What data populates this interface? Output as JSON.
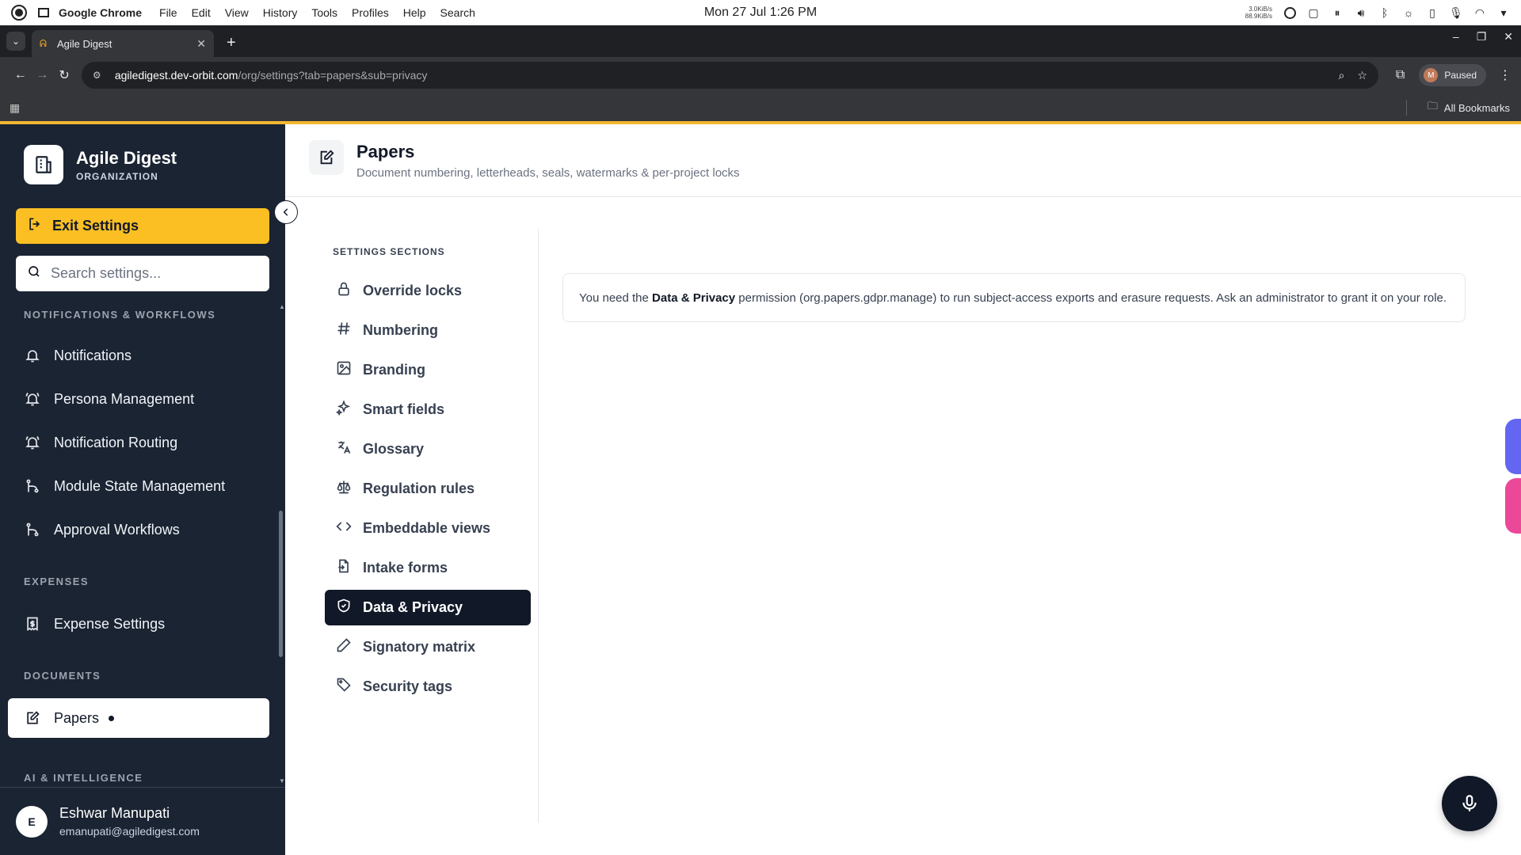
{
  "os": {
    "app_name": "Google Chrome",
    "menus": [
      "File",
      "Edit",
      "View",
      "History",
      "Tools",
      "Profiles",
      "Help",
      "Search"
    ],
    "clock": "Mon 27 Jul  1:26 PM",
    "net_up": "3.0KiB/s",
    "net_down": "88.9KiB/s"
  },
  "browser": {
    "tab_title": "Agile Digest",
    "url_domain": "agiledigest.dev-orbit.com",
    "url_path": "/org/settings?tab=papers&sub=privacy",
    "profile_initial": "M",
    "profile_status": "Paused",
    "bookmarks_label": "All Bookmarks"
  },
  "sidebar": {
    "org_name": "Agile Digest",
    "org_type": "ORGANIZATION",
    "exit_label": "Exit Settings",
    "search_placeholder": "Search settings...",
    "sections": [
      {
        "label": "NOTIFICATIONS & WORKFLOWS"
      },
      {
        "label": "EXPENSES"
      },
      {
        "label": "DOCUMENTS"
      },
      {
        "label": "AI & INTELLIGENCE"
      }
    ],
    "items": [
      {
        "label": "Notifications",
        "icon": "bell-icon"
      },
      {
        "label": "Persona Management",
        "icon": "bell-ring-icon"
      },
      {
        "label": "Notification Routing",
        "icon": "bell-ring-icon"
      },
      {
        "label": "Module State Management",
        "icon": "git-branch-icon"
      },
      {
        "label": "Approval Workflows",
        "icon": "git-branch-icon"
      },
      {
        "label": "Expense Settings",
        "icon": "receipt-icon"
      },
      {
        "label": "Papers",
        "icon": "edit-document-icon"
      }
    ],
    "user_initial": "E",
    "user_name": "Eshwar Manupati",
    "user_email": "emanupati@agiledigest.com"
  },
  "page": {
    "title": "Papers",
    "subtitle": "Document numbering, letterheads, seals, watermarks & per-project locks",
    "sections_label": "SETTINGS SECTIONS",
    "sections": [
      {
        "label": "Override locks",
        "icon": "lock-icon"
      },
      {
        "label": "Numbering",
        "icon": "hash-icon"
      },
      {
        "label": "Branding",
        "icon": "image-icon"
      },
      {
        "label": "Smart fields",
        "icon": "sparkles-icon"
      },
      {
        "label": "Glossary",
        "icon": "translate-icon"
      },
      {
        "label": "Regulation rules",
        "icon": "scale-icon"
      },
      {
        "label": "Embeddable views",
        "icon": "code-icon"
      },
      {
        "label": "Intake forms",
        "icon": "file-import-icon"
      },
      {
        "label": "Data & Privacy",
        "icon": "shield-check-icon"
      },
      {
        "label": "Signatory matrix",
        "icon": "pen-icon"
      },
      {
        "label": "Security tags",
        "icon": "tag-icon"
      }
    ],
    "notice": {
      "pre": "You need the ",
      "strong": "Data & Privacy",
      "post": " permission (org.papers.gdpr.manage) to run subject-access exports and erasure requests. Ask an administrator to grant it on your role."
    }
  },
  "colors": {
    "accent": "#fbbf24",
    "sidebar_bg": "#1b2433",
    "active_section": "#111827"
  }
}
